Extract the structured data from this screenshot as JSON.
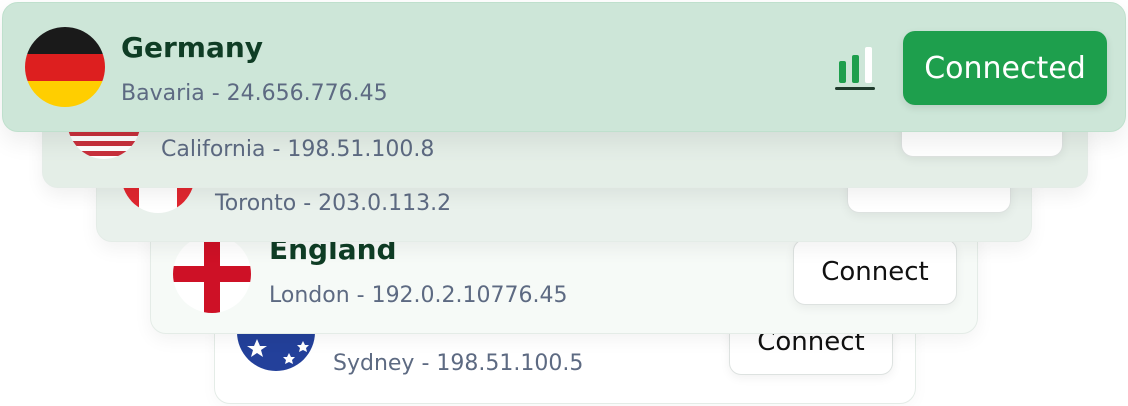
{
  "servers": [
    {
      "country": "Germany",
      "detail": "Bavaria - 24.656.776.45",
      "status": "Connected"
    },
    {
      "country": "",
      "detail": "California - 198.51.100.8"
    },
    {
      "country": "",
      "detail": "Toronto - 203.0.113.2"
    },
    {
      "country": "England",
      "detail": "London - 192.0.2.10776.45",
      "action": "Connect"
    },
    {
      "country": "",
      "detail": "Sydney - 198.51.100.5",
      "action": "Connect"
    }
  ],
  "icons": {
    "signal": "signal-strength-icon"
  },
  "colors": {
    "accent": "#1e9f4d",
    "title": "#0f3d25",
    "detail": "#5d6a82",
    "active_card": "#cde6d8"
  }
}
